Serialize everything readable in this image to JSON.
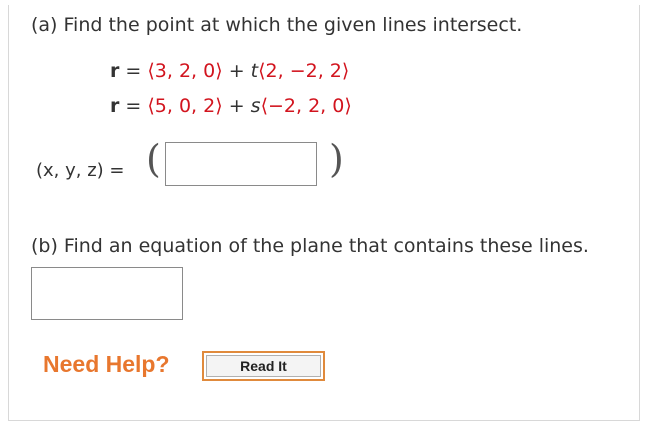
{
  "colors": {
    "accent_red": "#d2141e",
    "help_orange": "#e8772e"
  },
  "part_a": {
    "question": "(a) Find the point at which the given lines intersect.",
    "line1": {
      "lhs": "r",
      "equals": "=",
      "point": "⟨3, 2, 0⟩",
      "plus": "+",
      "param": "t",
      "direction": "⟨2, −2, 2⟩"
    },
    "line2": {
      "lhs": "r",
      "equals": "=",
      "point": "⟨5, 0, 2⟩",
      "plus": "+",
      "param": "s",
      "direction": "⟨−2, 2, 0⟩"
    },
    "answer_label": "(x, y, z) =",
    "open_paren": "(",
    "close_paren": ")",
    "answer_value": ""
  },
  "part_b": {
    "question": "(b) Find an equation of the plane that contains these lines.",
    "answer_value": ""
  },
  "help": {
    "label": "Need Help?",
    "read_it": "Read It"
  }
}
